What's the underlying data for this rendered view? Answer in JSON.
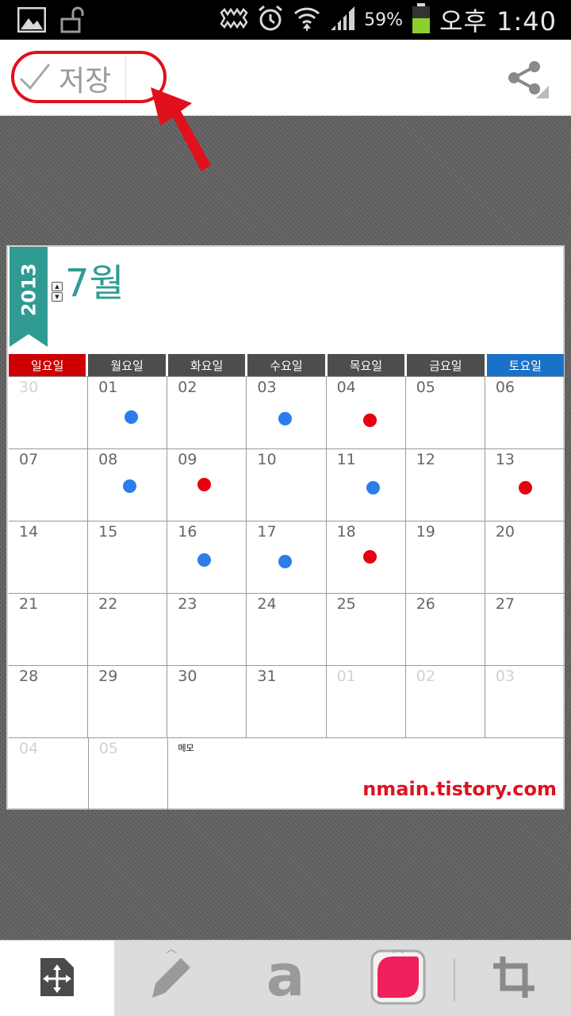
{
  "status_bar": {
    "battery_percent": "59%",
    "time": "오후 1:40",
    "icons": [
      "gallery-icon",
      "unlock-icon",
      "mute-icon",
      "alarm-icon",
      "wifi-icon",
      "signal-icon",
      "battery-icon"
    ]
  },
  "action_bar": {
    "save_label": "저장",
    "share_icon": "share-icon"
  },
  "calendar": {
    "year": "2013",
    "month_title": "7월",
    "weekdays": [
      {
        "label": "일요일",
        "color": "#cc0000"
      },
      {
        "label": "월요일",
        "color": "#4d4d4d"
      },
      {
        "label": "화요일",
        "color": "#4d4d4d"
      },
      {
        "label": "수요일",
        "color": "#4d4d4d"
      },
      {
        "label": "목요일",
        "color": "#4d4d4d"
      },
      {
        "label": "금요일",
        "color": "#4d4d4d"
      },
      {
        "label": "토요일",
        "color": "#1a72c8"
      }
    ],
    "weeks": [
      [
        "30",
        "01",
        "02",
        "03",
        "04",
        "05",
        "06"
      ],
      [
        "07",
        "08",
        "09",
        "10",
        "11",
        "12",
        "13"
      ],
      [
        "14",
        "15",
        "16",
        "17",
        "18",
        "19",
        "20"
      ],
      [
        "21",
        "22",
        "23",
        "24",
        "25",
        "26",
        "27"
      ],
      [
        "28",
        "29",
        "30",
        "31",
        "01",
        "02",
        "03"
      ]
    ],
    "faded_cells": [
      [
        0,
        0
      ],
      [
        4,
        4
      ],
      [
        4,
        5
      ],
      [
        4,
        6
      ]
    ],
    "extra_row": [
      "04",
      "05"
    ],
    "memo_label": "메모",
    "dot_colors": {
      "blue": "#2b7de9",
      "red": "#e8000f"
    },
    "dots": [
      {
        "day": "01",
        "color": "blue"
      },
      {
        "day": "03",
        "color": "blue"
      },
      {
        "day": "04",
        "color": "red"
      },
      {
        "day": "08",
        "color": "blue"
      },
      {
        "day": "09",
        "color": "red"
      },
      {
        "day": "11",
        "color": "blue"
      },
      {
        "day": "13",
        "color": "red"
      },
      {
        "day": "16",
        "color": "blue"
      },
      {
        "day": "17",
        "color": "blue"
      },
      {
        "day": "18",
        "color": "red"
      }
    ],
    "watermark": "nmain.tistory.com",
    "ribbon_color": "#2f9b93"
  },
  "toolbar": {
    "tools": [
      "move-icon",
      "pen-icon",
      "text-tool-icon",
      "color-icon",
      "crop-icon"
    ],
    "text_tool_glyph": "a",
    "active_color": "#f0205c"
  }
}
